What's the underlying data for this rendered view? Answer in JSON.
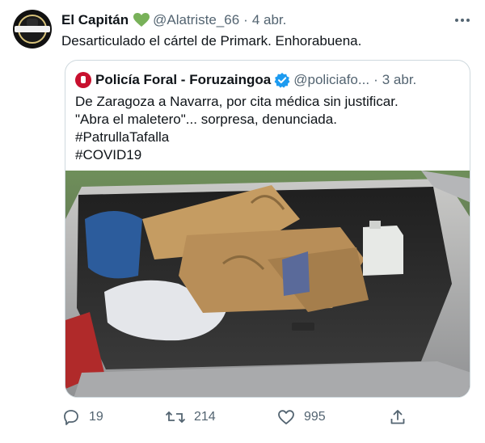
{
  "tweet": {
    "author_name": "El Capitán",
    "author_emoji": "green-heart-icon",
    "handle": "@Alatriste_66",
    "separator": "·",
    "date": "4 abr.",
    "text": "Desarticulado el cártel de Primark. Enhorabuena."
  },
  "quoted": {
    "author_name": "Policía Foral - Foruzaingoa",
    "handle": "@policiafo...",
    "separator": "·",
    "date": "3 abr.",
    "text": "De Zaragoza a Navarra, por cita médica sin justificar.\n\"Abra el maletero\"... sorpresa, denunciada.\n#PatrullaTafalla\n#COVID19",
    "media_description_icon": "photo"
  },
  "actions": {
    "reply_count": "19",
    "retweet_count": "214",
    "like_count": "995"
  },
  "colors": {
    "text": "#0f1419",
    "secondary": "#536471",
    "border": "#cfd9de",
    "verified": "#1d9bf0",
    "heart": "#78b159",
    "police_red": "#c8102e"
  }
}
